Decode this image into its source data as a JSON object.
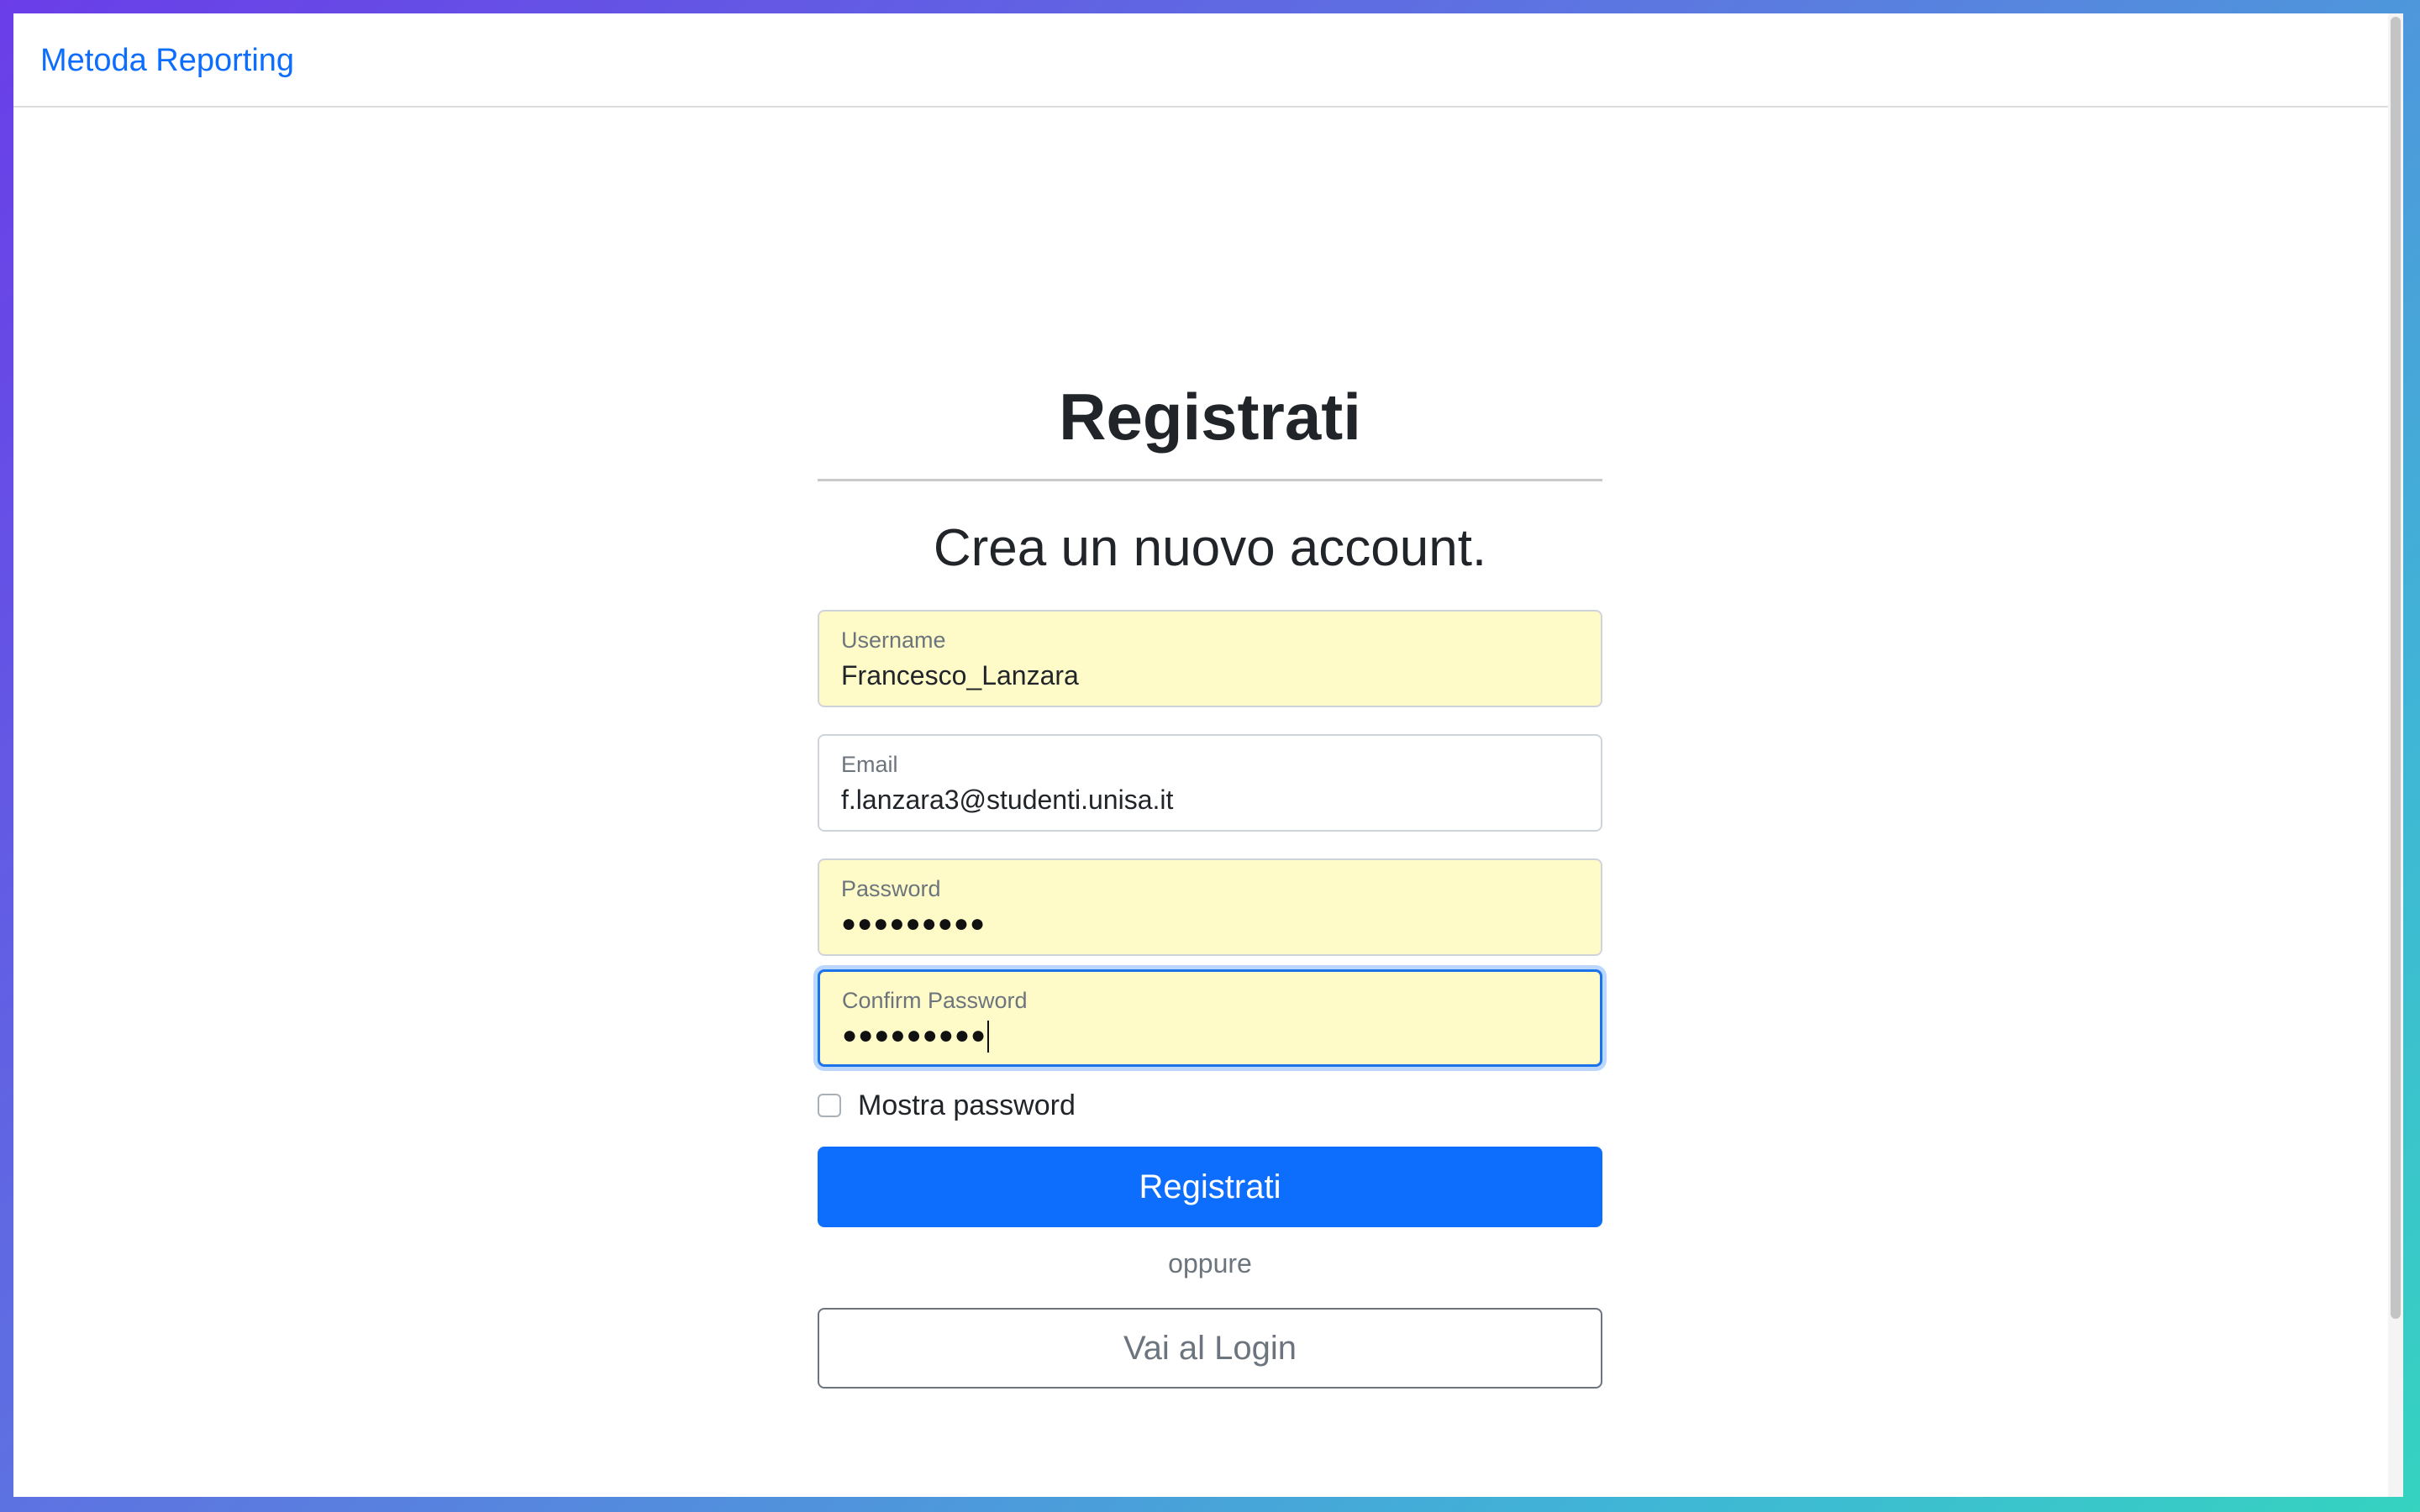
{
  "navbar": {
    "brand": "Metoda Reporting"
  },
  "page": {
    "title": "Registrati",
    "subtitle": "Crea un nuovo account."
  },
  "form": {
    "username": {
      "label": "Username",
      "value": "Francesco_Lanzara"
    },
    "email": {
      "label": "Email",
      "value": "f.lanzara3@studenti.unisa.it"
    },
    "password": {
      "label": "Password",
      "value": "●●●●●●●●●"
    },
    "confirm_password": {
      "label": "Confirm Password",
      "value": "●●●●●●●●●"
    },
    "show_password": {
      "label": "Mostra password",
      "checked": false
    },
    "submit_label": "Registrati",
    "separator": "oppure",
    "login_label": "Vai al Login"
  },
  "colors": {
    "primary": "#0d6efd",
    "autofill": "#fefbc8",
    "focus": "#1a73e8"
  }
}
